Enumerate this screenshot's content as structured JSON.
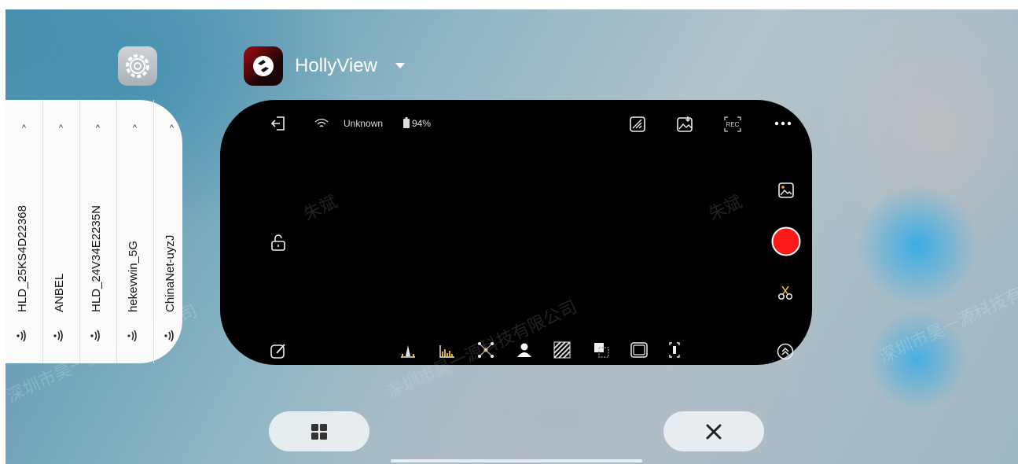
{
  "settings_app": {
    "icon": "gear-icon",
    "wifi_networks": [
      {
        "ssid": "HLD_25KS4D22368"
      },
      {
        "ssid": "ANBEL"
      },
      {
        "ssid": "HLD_24V34E2235N"
      },
      {
        "ssid": "hekevwin_5G"
      },
      {
        "ssid": "ChinaNet-uyzJ"
      }
    ]
  },
  "app_card": {
    "title": "HollyView",
    "status": {
      "network": "Unknown",
      "battery": "94%"
    },
    "watermarks": [
      "朱斌",
      "朱斌",
      "深圳市昊一源科技有限公司",
      "深圳市昊一源科技有限公司",
      "深圳市昊一源科技有限公司"
    ],
    "record_color": "#ff1a1a"
  },
  "colors": {
    "card_bg": "#000000",
    "settings_bg": "#fbfbfb"
  }
}
